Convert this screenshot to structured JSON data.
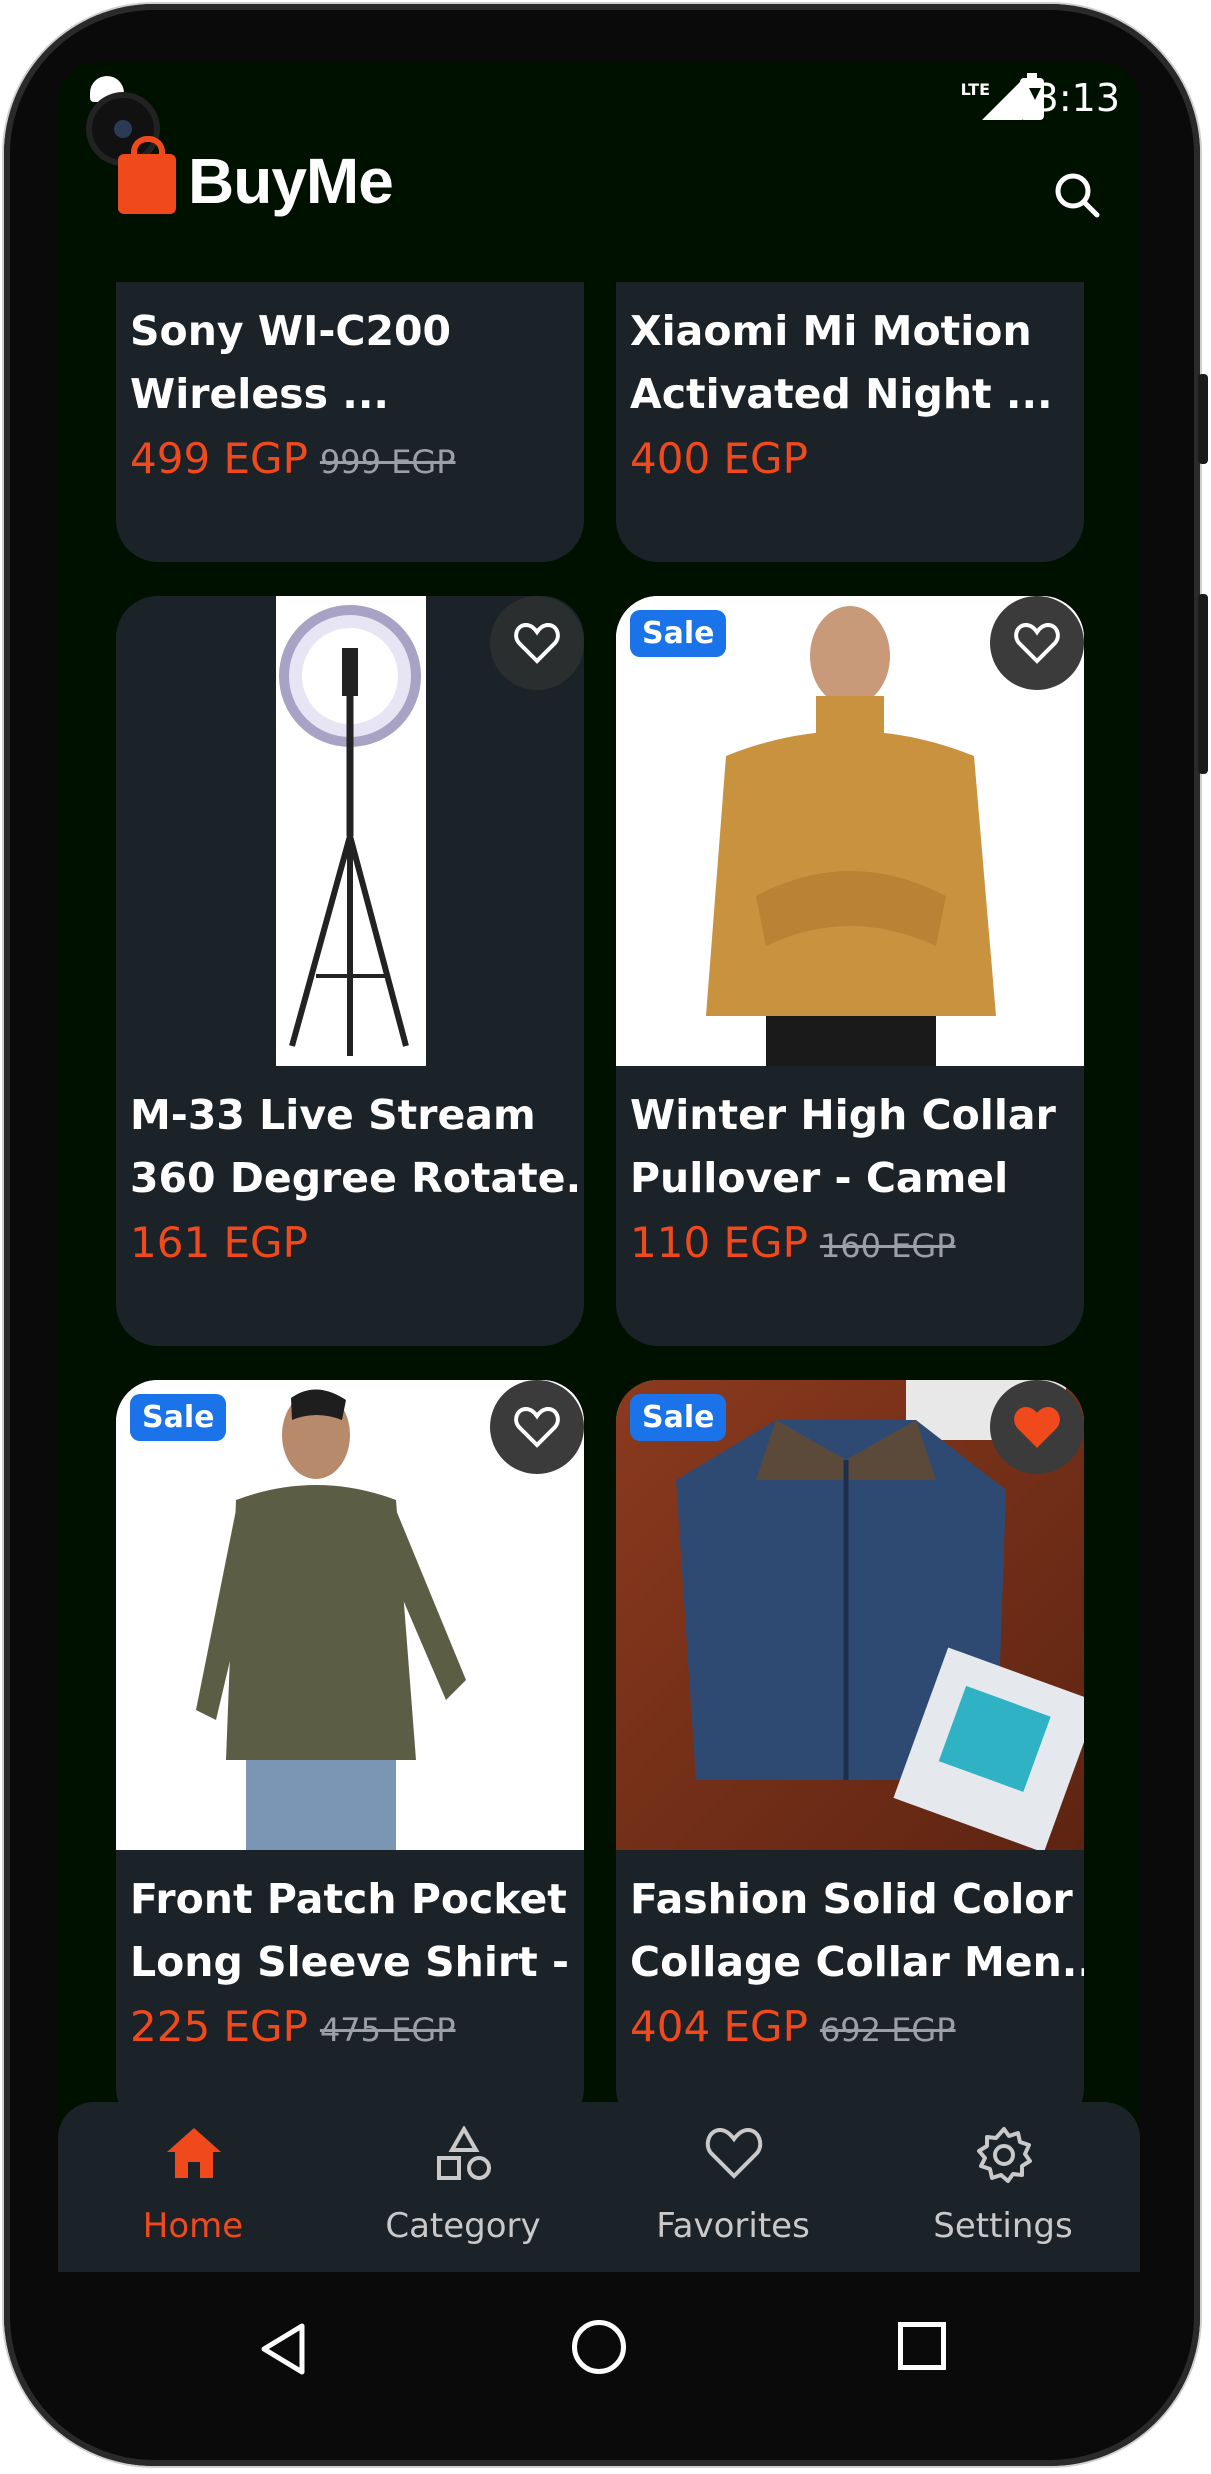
{
  "status_bar": {
    "time": "3:13",
    "network": "LTE"
  },
  "app": {
    "title": "BuyMe"
  },
  "products": [
    {
      "name": "Sony WI-C200\nWireless ...",
      "price": "499 EGP",
      "old_price": "999 EGP",
      "sale": false,
      "favorite": false,
      "image": "headphones"
    },
    {
      "name": "Xiaomi Mi Motion\nActivated Night ...",
      "price": "400 EGP",
      "old_price": "",
      "sale": false,
      "favorite": false,
      "image": "night-light"
    },
    {
      "name": "M-33 Live Stream\n360 Degree Rotate...",
      "price": "161 EGP",
      "old_price": "",
      "sale": false,
      "favorite": false,
      "image": "ring-light-tripod"
    },
    {
      "name": "Winter High Collar\nPullover - Camel",
      "price": "110 EGP",
      "old_price": "160 EGP",
      "sale": true,
      "sale_label": "Sale",
      "favorite": false,
      "image": "camel-pullover"
    },
    {
      "name": "Front Patch Pocket\nLong Sleeve Shirt - ...",
      "price": "225 EGP",
      "old_price": "475 EGP",
      "sale": true,
      "sale_label": "Sale",
      "favorite": false,
      "image": "olive-shirt"
    },
    {
      "name": "Fashion Solid Color\nCollage Collar Men...",
      "price": "404 EGP",
      "old_price": "692 EGP",
      "sale": true,
      "sale_label": "Sale",
      "favorite": true,
      "image": "quilted-jacket"
    }
  ],
  "bottom_nav": {
    "items": [
      {
        "label": "Home",
        "icon": "home-icon",
        "active": true
      },
      {
        "label": "Category",
        "icon": "shapes-icon",
        "active": false
      },
      {
        "label": "Favorites",
        "icon": "heart-icon",
        "active": false
      },
      {
        "label": "Settings",
        "icon": "gear-icon",
        "active": false
      }
    ]
  },
  "colors": {
    "accent": "#f04a1c",
    "card": "#1b2329",
    "background": "#001100",
    "sale_badge": "#1a73e8"
  }
}
